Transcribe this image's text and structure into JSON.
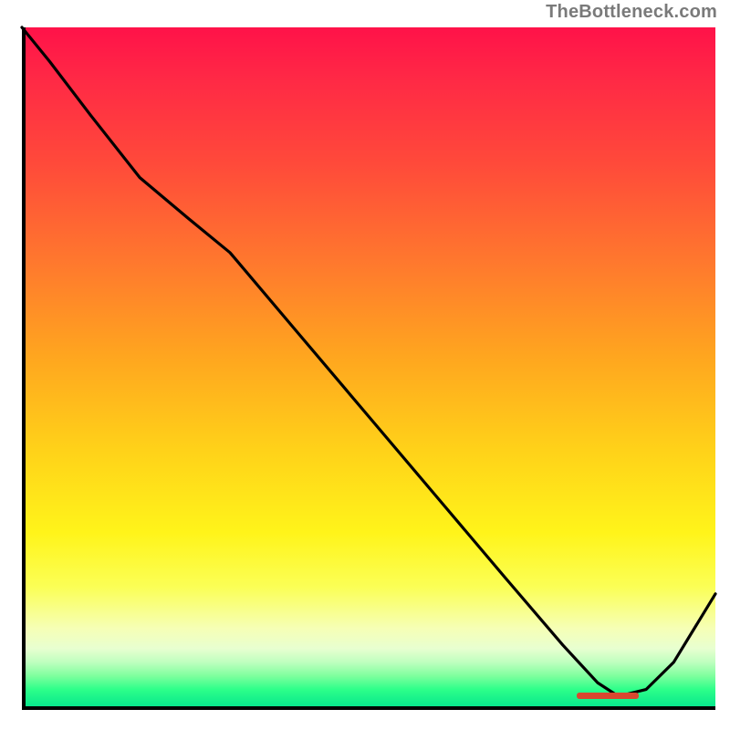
{
  "attribution": "TheBottleneck.com",
  "chart_data": {
    "type": "line",
    "x": [
      0.0,
      0.04,
      0.1,
      0.17,
      0.24,
      0.3,
      0.4,
      0.5,
      0.6,
      0.7,
      0.78,
      0.83,
      0.86,
      0.9,
      0.94,
      1.0
    ],
    "values": [
      1.0,
      0.95,
      0.87,
      0.78,
      0.72,
      0.67,
      0.55,
      0.43,
      0.31,
      0.19,
      0.095,
      0.04,
      0.02,
      0.03,
      0.07,
      0.17
    ],
    "title": "",
    "xlabel": "",
    "ylabel": "",
    "xlim": [
      0,
      1
    ],
    "ylim": [
      0,
      1
    ],
    "series_color": "#000000",
    "marker": {
      "x_start": 0.8,
      "x_end": 0.89,
      "y": 0.022,
      "color": "#d9472f"
    },
    "background_gradient_top": "#ff1249",
    "background_gradient_bottom": "#00e28c"
  }
}
